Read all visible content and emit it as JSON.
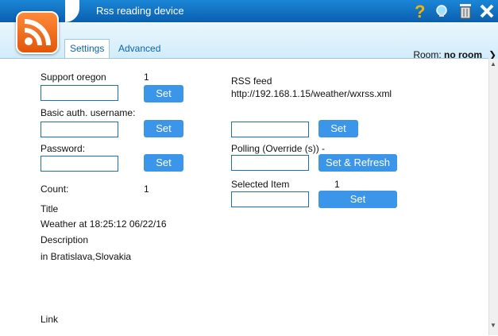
{
  "window": {
    "title": "Rss reading device"
  },
  "header": {
    "room_label": "Room:",
    "room_value": "no room"
  },
  "tabs": {
    "settings": "Settings",
    "advanced": "Advanced"
  },
  "left": {
    "support_label": "Support oregon",
    "support_value": "1",
    "basic_auth_label": "Basic auth. username:",
    "password_label": "Password:",
    "count_label": "Count:",
    "count_value": "1",
    "title_label": "Title",
    "title_value": "Weather at 18:25:12 06/22/16",
    "description_label": "Description",
    "description_value": "in Bratislava,Slovakia",
    "link_label": "Link"
  },
  "right": {
    "rss_feed_label": "RSS feed",
    "rss_feed_value": "http://192.168.1.15/weather/wxrss.xml",
    "polling_label": "Polling (Override (s)) -",
    "selected_item_label": "Selected Item",
    "selected_item_value": "1"
  },
  "buttons": {
    "set": "Set",
    "set_refresh": "Set & Refresh"
  },
  "icons": {
    "help": "question-icon",
    "bulb": "bulb-icon",
    "trash": "trash-icon",
    "close": "close-icon"
  },
  "colors": {
    "accent": "#0a63b3",
    "button": "#3b95e8",
    "rss": "#f26b1d"
  }
}
